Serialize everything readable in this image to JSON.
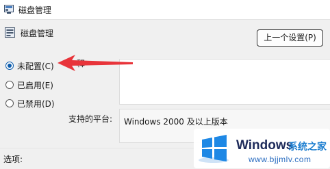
{
  "window": {
    "title": "磁盘管理"
  },
  "header": {
    "title": "磁盘管理"
  },
  "buttons": {
    "previous_setting": "上一个设置(P)"
  },
  "options": {
    "not_configured": "未配置(C)",
    "enabled": "已启用(E)",
    "disabled": "已禁用(D)",
    "selected": "not_configured"
  },
  "labels": {
    "comment": "释",
    "supported_on": "支持的平台:",
    "options": "选项:"
  },
  "supported_on_value": "Windows 2000 及以上版本",
  "watermark": {
    "brand": "Windows",
    "brand_cn": "系统之家",
    "url": "www.bjjmlv.com"
  },
  "colors": {
    "accent": "#0b5cad",
    "arrow": "#e8343a",
    "windows_blue": "#1e88e5"
  }
}
